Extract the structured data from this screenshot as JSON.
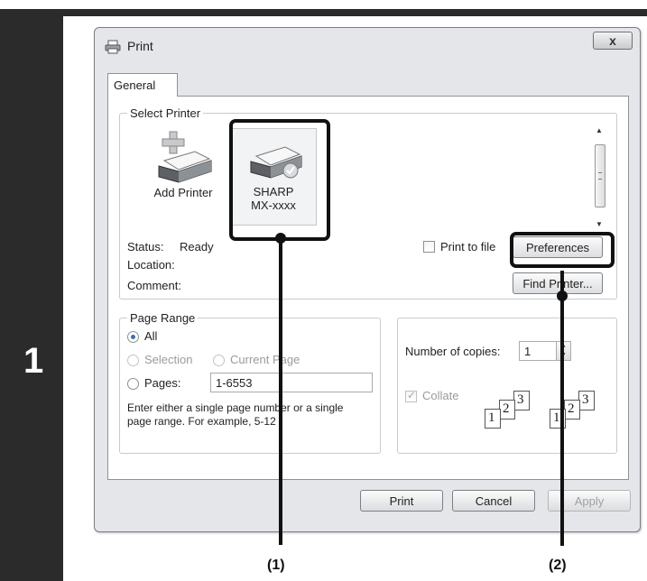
{
  "step": {
    "number": "1"
  },
  "dialog": {
    "title": "Print",
    "close_label": "x",
    "tab": "General"
  },
  "select_printer": {
    "legend": "Select Printer",
    "add_printer": "Add Printer",
    "printer_name_line1": "SHARP",
    "printer_name_line2": "MX-xxxx",
    "status_label": "Status:",
    "status_value": "Ready",
    "location_label": "Location:",
    "comment_label": "Comment:",
    "print_to_file": "Print to file",
    "preferences": "Preferences",
    "find_printer": "Find Printer..."
  },
  "page_range": {
    "legend": "Page Range",
    "all": "All",
    "selection": "Selection",
    "current_page": "Current Page",
    "pages": "Pages:",
    "pages_value": "1-6553",
    "hint_line1": "Enter either a single page number or a single",
    "hint_line2": "page range.  For example, 5-12"
  },
  "copies": {
    "label": "Number of copies:",
    "value": "1",
    "collate": "Collate",
    "collate_pages": [
      "1",
      "2",
      "3",
      "1",
      "2",
      "3"
    ]
  },
  "buttons": {
    "print": "Print",
    "cancel": "Cancel",
    "apply": "Apply"
  },
  "callouts": {
    "one": "(1)",
    "two": "(2)"
  },
  "colors": {
    "highlight": "#111111",
    "step_bar": "#2b2b2b",
    "radio_selected": "#3a6fb5"
  }
}
